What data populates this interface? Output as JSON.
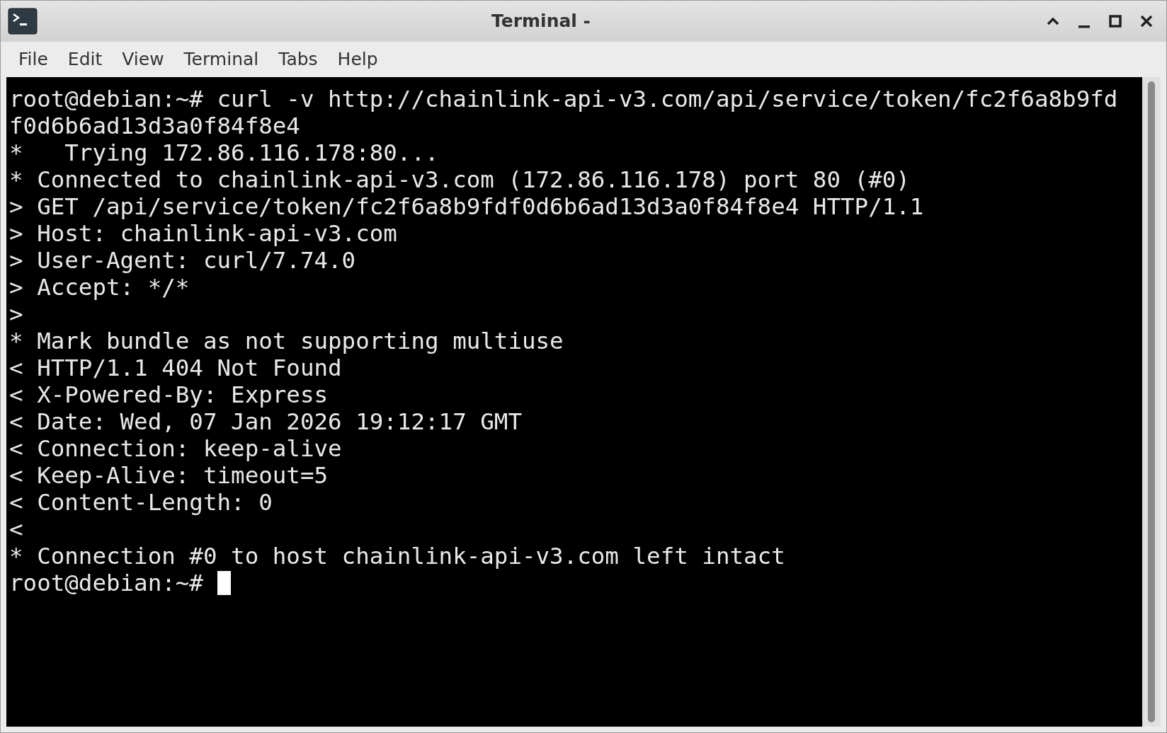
{
  "window": {
    "title": "Terminal -"
  },
  "menu": [
    "File",
    "Edit",
    "View",
    "Terminal",
    "Tabs",
    "Help"
  ],
  "terminal": {
    "lines": [
      "root@debian:~# curl -v http://chainlink-api-v3.com/api/service/token/fc2f6a8b9fd",
      "f0d6b6ad13d3a0f84f8e4",
      "*   Trying 172.86.116.178:80...",
      "* Connected to chainlink-api-v3.com (172.86.116.178) port 80 (#0)",
      "> GET /api/service/token/fc2f6a8b9fdf0d6b6ad13d3a0f84f8e4 HTTP/1.1",
      "> Host: chainlink-api-v3.com",
      "> User-Agent: curl/7.74.0",
      "> Accept: */*",
      ">",
      "* Mark bundle as not supporting multiuse",
      "< HTTP/1.1 404 Not Found",
      "< X-Powered-By: Express",
      "< Date: Wed, 07 Jan 2026 19:12:17 GMT",
      "< Connection: keep-alive",
      "< Keep-Alive: timeout=5",
      "< Content-Length: 0",
      "<",
      "* Connection #0 to host chainlink-api-v3.com left intact"
    ],
    "prompt": "root@debian:~#"
  }
}
